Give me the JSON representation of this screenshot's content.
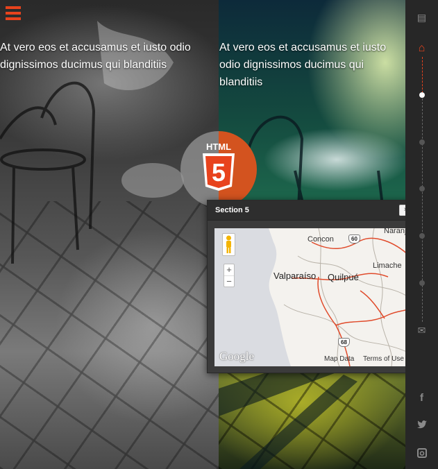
{
  "scenes": {
    "left_text": "At vero eos et accusamus et iusto odio dignissimos ducimus qui blanditiis",
    "right_text": "At vero eos et accusamus et iusto odio dignissimos ducimus qui blanditiis"
  },
  "badge": {
    "label": "HTML",
    "number": "5"
  },
  "popup": {
    "title": "Section 5",
    "close_label": "×",
    "map": {
      "places": {
        "concon": "Concon",
        "valparaiso": "Valparaíso",
        "quilpue": "Quilpué",
        "limache": "Limache",
        "top_right": "Naranja"
      },
      "routes": {
        "r60": "60",
        "r68": "68"
      },
      "zoom_in": "+",
      "zoom_out": "−",
      "logo": "Google",
      "map_data": "Map Data",
      "terms": "Terms of Use"
    }
  },
  "colors": {
    "accent": "#e8431d",
    "sidebar_bg": "#272727",
    "html5_orange": "#d3531f"
  },
  "sidebar": {
    "icons": [
      "newspaper-icon",
      "home-icon",
      "mail-icon",
      "facebook-icon",
      "twitter-icon",
      "instagram-icon"
    ],
    "glyphs": {
      "newspaper": "▤",
      "home": "⌂",
      "mail": "✉",
      "facebook": "f",
      "twitter": "🐦",
      "instagram": "◙"
    },
    "active_section": 1,
    "section_count": 6
  }
}
